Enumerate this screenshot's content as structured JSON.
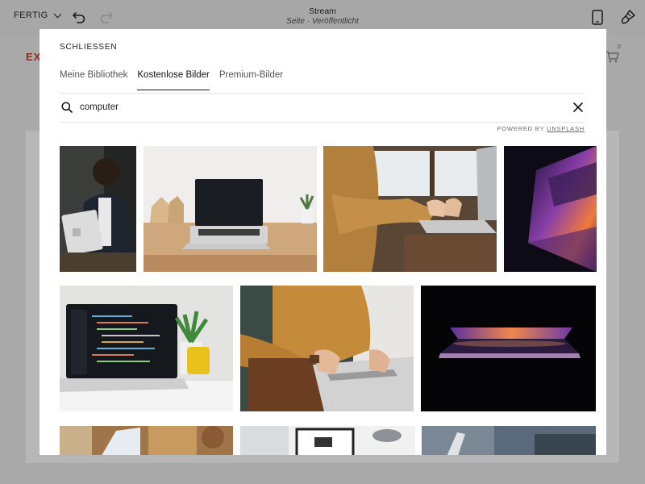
{
  "topbar": {
    "done_label": "FERTIG",
    "page_title": "Stream",
    "page_status": "Seite · Veröffentlicht"
  },
  "site": {
    "logo_text": "EX",
    "cart_count": "0"
  },
  "modal": {
    "close_label": "SCHLIESSEN",
    "tabs": [
      {
        "label": "Meine Bibliothek",
        "active": false
      },
      {
        "label": "Kostenlose Bilder",
        "active": true
      },
      {
        "label": "Premium-Bilder",
        "active": false
      }
    ],
    "search": {
      "value": "computer"
    },
    "powered_prefix": "POWERED BY",
    "powered_link": "UNSPLASH"
  },
  "images": [
    {
      "subject": "person holding tablet"
    },
    {
      "subject": "laptop on wooden desk"
    },
    {
      "subject": "hands typing on laptop by window"
    },
    {
      "subject": "colorful lit laptop edge"
    },
    {
      "subject": "laptop with code and plant"
    },
    {
      "subject": "person in yellow sweater typing"
    },
    {
      "subject": "laptop glowing in dark"
    },
    {
      "subject": "laptop at cafe table"
    },
    {
      "subject": "desk with monitor and lamp"
    },
    {
      "subject": "laptop in blurry room"
    }
  ],
  "icons": {
    "undo": "undo-icon",
    "redo": "redo-icon",
    "mobile": "mobile-icon",
    "brush": "brush-icon",
    "search": "search-icon",
    "clear": "close-icon",
    "cart": "cart-icon"
  }
}
